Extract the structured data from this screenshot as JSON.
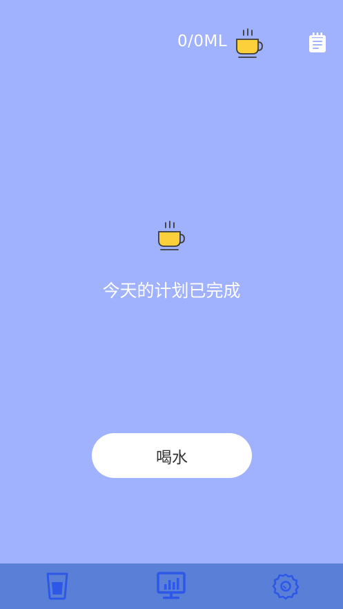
{
  "header": {
    "intake_text": "0/0ML",
    "cup_icon": "coffee-cup-icon",
    "log_icon": "notepad-icon"
  },
  "main": {
    "cup_icon": "coffee-cup-icon",
    "message": "今天的计划已完成",
    "drink_button_label": "喝水"
  },
  "tabbar": {
    "items": [
      {
        "icon": "water-glass-icon",
        "active": true
      },
      {
        "icon": "chart-board-icon",
        "active": false
      },
      {
        "icon": "settings-gear-icon",
        "active": false
      }
    ]
  },
  "colors": {
    "background": "#a0b1fe",
    "tabbar": "#5a7fd6",
    "tab_icon": "#2d57e6",
    "cup_fill": "#fcd03a",
    "cup_outline": "#3a3a3a",
    "button_bg": "#ffffff"
  }
}
